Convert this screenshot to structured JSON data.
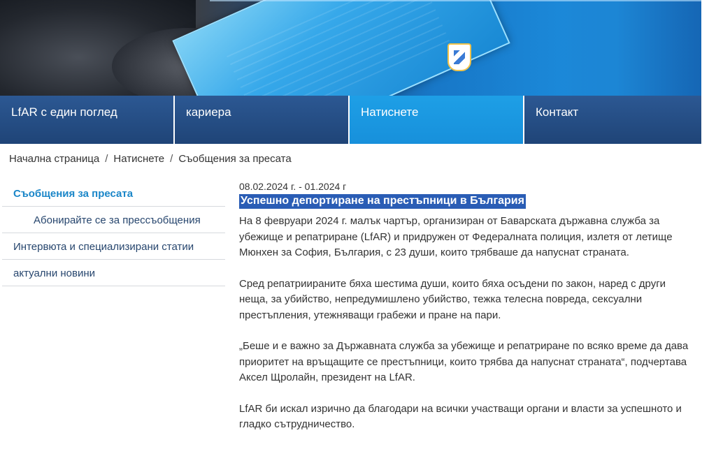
{
  "nav": {
    "items": [
      {
        "label": "LfAR с един поглед",
        "active": false
      },
      {
        "label": "кариера",
        "active": false
      },
      {
        "label": "Натиснете",
        "active": true
      },
      {
        "label": "Контакт",
        "active": false
      }
    ]
  },
  "breadcrumb": {
    "items": [
      "Начална страница",
      "Натиснете",
      "Съобщения за пресата"
    ],
    "separator": "/"
  },
  "sidebar": {
    "items": [
      {
        "label": "Съобщения за пресата",
        "active": true,
        "sub": false
      },
      {
        "label": "Абонирайте се за прессъобщения",
        "active": false,
        "sub": true
      },
      {
        "label": "Интервюта и специализирани статии",
        "active": false,
        "sub": false
      },
      {
        "label": "актуални новини",
        "active": false,
        "sub": false
      }
    ]
  },
  "article": {
    "date": "08.02.2024 г. - 01.2024 г",
    "title": "Успешно депортиране на престъпници в България",
    "paragraphs": [
      "На 8 февруари 2024 г. малък чартър, организиран от Баварската държавна служба за убежище и репатриране (LfAR) и придружен от Федералната полиция, излетя от летище Мюнхен за София, България, с 23 души, които трябваше да напуснат страната.",
      "Сред репатриираните бяха шестима души, които бяха осъдени по закон, наред с други неща, за убийство, непредумишлено убийство, тежка телесна повреда, сексуални престъпления, утежняващи грабежи и пране на пари.",
      "„Беше и е важно за Държавната служба за убежище и репатриране по всяко време да дава приоритет на връщащите се престъпници, които трябва да напуснат страната“, подчертава Аксел Щролайн, президент на LfAR.",
      "LfAR би искал изрично да благодари на всички участващи органи и власти за успешното и гладко сътрудничество."
    ]
  },
  "colors": {
    "nav_bg": "#234d85",
    "nav_active": "#1b98e0",
    "sidebar_active": "#1a86c8",
    "headline_highlight": "#2a5db5"
  }
}
